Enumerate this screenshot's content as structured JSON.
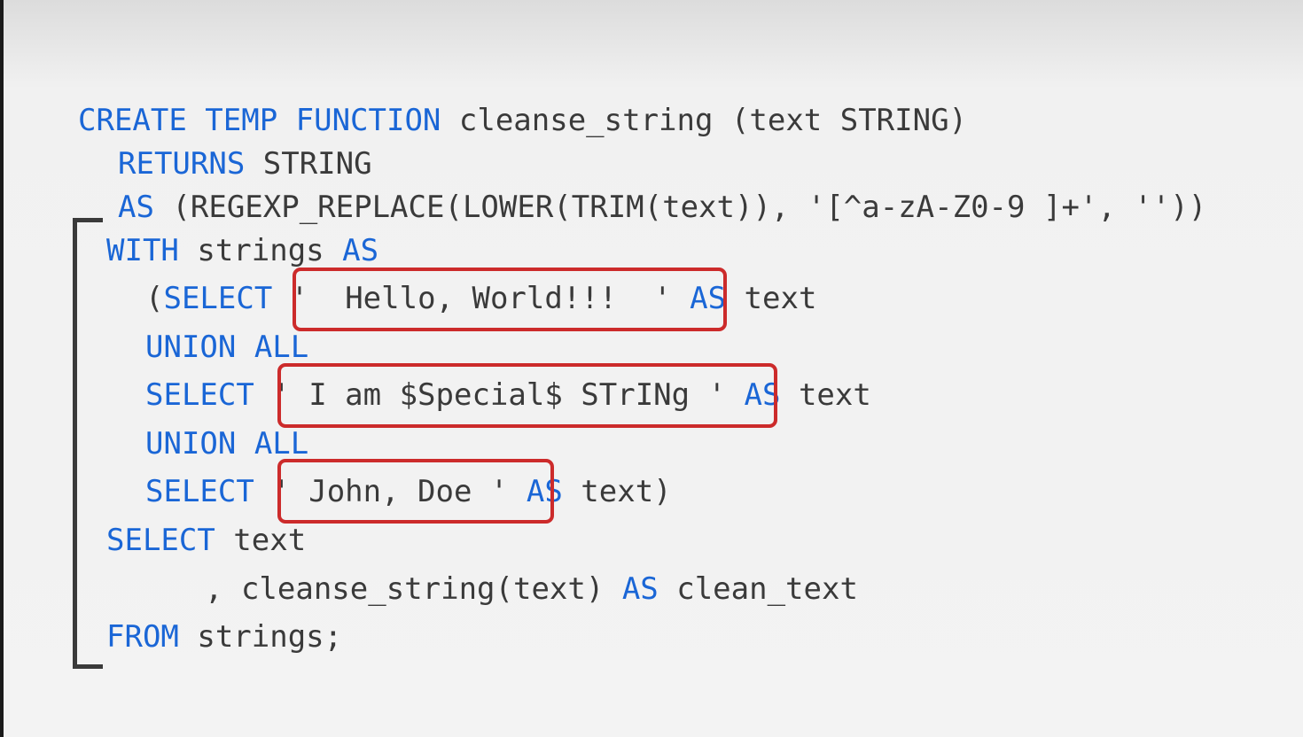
{
  "code_lines": [
    [
      {
        "t": "CREATE TEMP FUNCTION",
        "k": true
      },
      {
        "t": " cleanse_string (text STRING)",
        "k": false
      }
    ],
    [
      {
        "t": "RETURNS",
        "k": true
      },
      {
        "t": " STRING",
        "k": false
      }
    ],
    [
      {
        "t": "AS",
        "k": true
      },
      {
        "t": " (REGEXP_REPLACE(LOWER(TRIM(text)), '[^a-zA-Z0-9 ]+', ''))",
        "k": false
      }
    ],
    [
      {
        "t": "WITH",
        "k": true
      },
      {
        "t": " strings ",
        "k": false
      },
      {
        "t": "AS",
        "k": true
      }
    ],
    [
      {
        "t": "(",
        "k": false
      },
      {
        "t": "SELECT",
        "k": true
      },
      {
        "t": " '  Hello, World!!!  ' ",
        "k": false
      },
      {
        "t": "AS",
        "k": true
      },
      {
        "t": " text",
        "k": false
      }
    ],
    [
      {
        "t": "UNION ALL",
        "k": true
      }
    ],
    [
      {
        "t": "SELECT",
        "k": true
      },
      {
        "t": " ' I am $Special$ STrINg ' ",
        "k": false
      },
      {
        "t": "AS",
        "k": true
      },
      {
        "t": " text",
        "k": false
      }
    ],
    [
      {
        "t": "UNION ALL",
        "k": true
      }
    ],
    [
      {
        "t": "SELECT",
        "k": true
      },
      {
        "t": " ' John, Doe ' ",
        "k": false
      },
      {
        "t": "AS",
        "k": true
      },
      {
        "t": " text)",
        "k": false
      }
    ],
    [
      {
        "t": "SELECT",
        "k": true
      },
      {
        "t": " text",
        "k": false
      }
    ],
    [
      {
        "t": ", cleanse_string(text) ",
        "k": false
      },
      {
        "t": "AS",
        "k": true
      },
      {
        "t": " clean_text",
        "k": false
      }
    ],
    [
      {
        "t": "FROM",
        "k": true
      },
      {
        "t": " strings;",
        "k": false
      }
    ]
  ],
  "colors": {
    "keyword": "#1a66d6",
    "text": "#3a3a3a",
    "highlight_border": "#cc2b2b"
  }
}
